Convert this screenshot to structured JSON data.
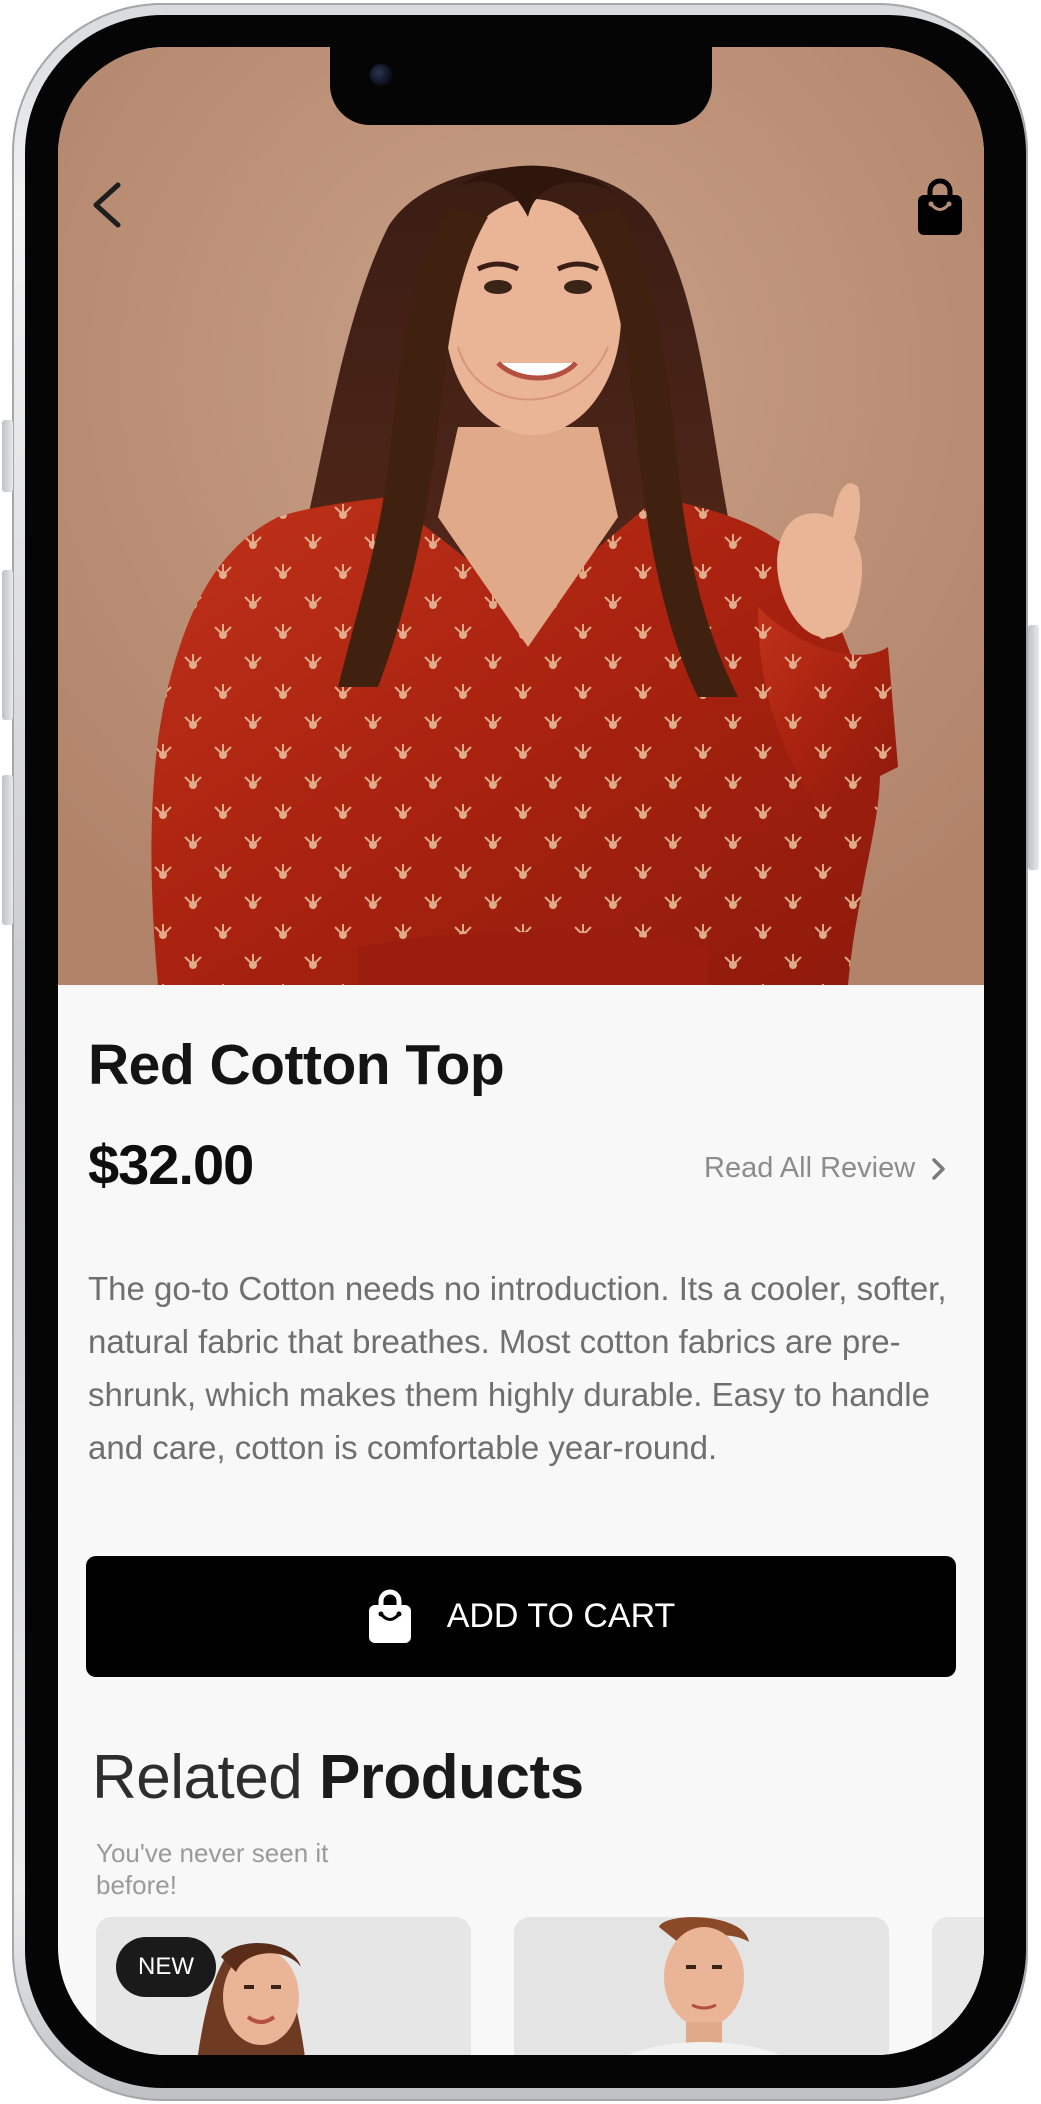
{
  "header": {
    "back_icon": "chevron-left-icon",
    "cart_icon": "shopping-bag-icon"
  },
  "product": {
    "title": "Red Cotton Top",
    "price": "$32.00",
    "reviews_link": "Read All Review",
    "description": "The go-to Cotton needs no introduction. Its a cooler, softer, natural fabric that breathes. Most cotton fabrics are pre-shrunk, which makes them highly durable. Easy to handle and care, cotton is comfortable year-round."
  },
  "cta": {
    "label": "ADD TO CART",
    "icon": "shopping-bag-icon"
  },
  "related": {
    "heading_light": "Related ",
    "heading_bold": "Products",
    "subtitle": "You've never seen it before!",
    "cards": [
      {
        "badge": "NEW"
      },
      {
        "badge": ""
      },
      {
        "badge": ""
      }
    ]
  },
  "colors": {
    "background": "#f8f8f8",
    "button": "#000000",
    "title": "#141414",
    "muted": "#8c8c8c"
  }
}
